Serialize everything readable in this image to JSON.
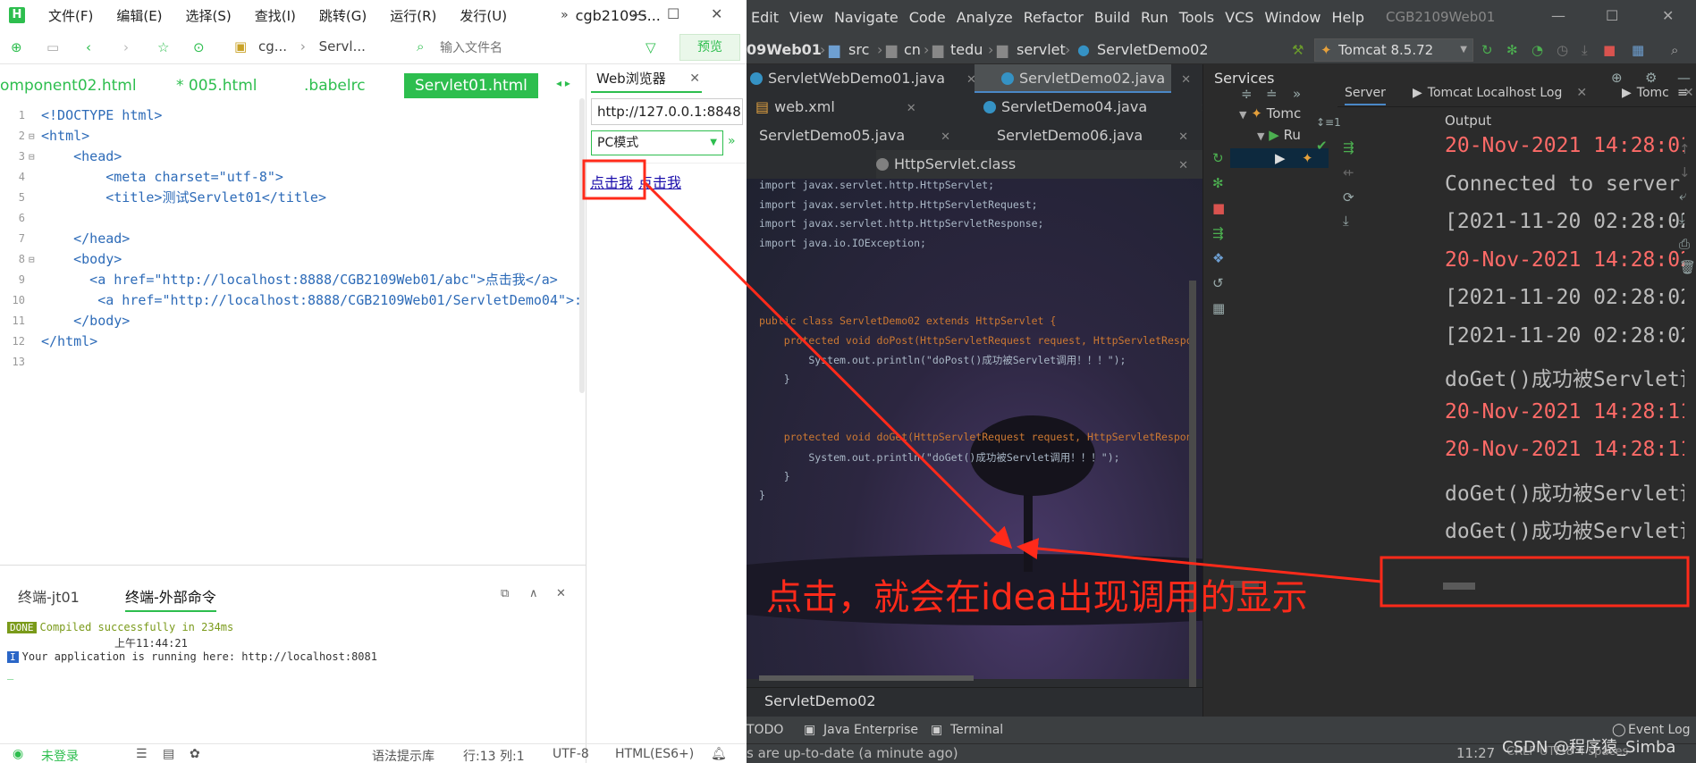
{
  "hbuilderx": {
    "menu": [
      "文件(F)",
      "编辑(E)",
      "选择(S)",
      "查找(I)",
      "跳转(G)",
      "运行(R)",
      "发行(U)"
    ],
    "title": "cgb2109S...",
    "toolbar": {
      "path": [
        "cg...",
        "Servl..."
      ],
      "file_input_placeholder": "输入文件名",
      "preview_label": "预览"
    },
    "tabs": [
      {
        "label": "omponent02.html"
      },
      {
        "label": "* 005.html"
      },
      {
        "label": ".babelrc"
      },
      {
        "label": "Servlet01.html",
        "active": true
      }
    ],
    "code_lines": [
      {
        "n": "1",
        "fold": "",
        "text": "<!DOCTYPE html>"
      },
      {
        "n": "2",
        "fold": "⊟",
        "text": "<html>"
      },
      {
        "n": "3",
        "fold": "⊟",
        "text": "    <head>"
      },
      {
        "n": "4",
        "fold": "",
        "text": "        <meta charset=\"utf-8\">"
      },
      {
        "n": "5",
        "fold": "",
        "text": "        <title>测试Servlet01</title>"
      },
      {
        "n": "6",
        "fold": "",
        "text": ""
      },
      {
        "n": "7",
        "fold": "",
        "text": "    </head>"
      },
      {
        "n": "8",
        "fold": "⊟",
        "text": "    <body>"
      },
      {
        "n": "9",
        "fold": "",
        "text": "      <a href=\"http://localhost:8888/CGB2109Web01/abc\">点击我</a>"
      },
      {
        "n": "10",
        "fold": "",
        "text": "       <a href=\"http://localhost:8888/CGB2109Web01/ServletDemo04\">:"
      },
      {
        "n": "11",
        "fold": "",
        "text": "    </body>"
      },
      {
        "n": "12",
        "fold": "",
        "text": "</html>"
      },
      {
        "n": "13",
        "fold": "",
        "text": ""
      }
    ],
    "browser": {
      "tab_label": "Web浏览器",
      "url": "http://127.0.0.1:8848",
      "mode": "PC模式",
      "links": [
        "点击我",
        "点击我"
      ]
    },
    "terminal": {
      "tabs": [
        "终端-jt01",
        "终端-外部命令"
      ],
      "lines": [
        {
          "badge": "DONE",
          "text": "Compiled successfully in 234ms"
        },
        {
          "badge": "",
          "text": "上午11:44:21"
        },
        {
          "badge": "I",
          "text": "Your application is running here: http://localhost:8081"
        },
        {
          "badge": "",
          "text": "_"
        }
      ]
    },
    "status": {
      "login": "未登录",
      "hint": "语法提示库",
      "position": "行:13  列:1",
      "encoding": "UTF-8",
      "language": "HTML(ES6+)"
    }
  },
  "idea": {
    "menu": [
      "Edit",
      "View",
      "Navigate",
      "Code",
      "Analyze",
      "Refactor",
      "Build",
      "Run",
      "Tools",
      "VCS",
      "Window",
      "Help"
    ],
    "project_title": "CGB2109Web01",
    "breadcrumb": [
      "09Web01",
      "src",
      "cn",
      "tedu",
      "servlet",
      "ServletDemo02"
    ],
    "run_config": "Tomcat 8.5.72",
    "editor_tabs": [
      [
        "ServletWebDemo01.java",
        "ServletDemo02.java"
      ],
      [
        "web.xml",
        "ServletDemo04.java"
      ],
      [
        "ServletDemo05.java",
        "ServletDemo06.java"
      ],
      [
        "HttpServlet.class"
      ]
    ],
    "editor_code": [
      "import javax.servlet.http.HttpServlet;",
      "import javax.servlet.http.HttpServletRequest;",
      "import javax.servlet.http.HttpServletResponse;",
      "import java.io.IOException;",
      "",
      "",
      "",
      "public class ServletDemo02 extends HttpServlet {",
      "    protected void doPost(HttpServletRequest request, HttpServletRespo",
      "        System.out.println(\"doPost()成功被Servlet调用！！！\");",
      "    }",
      "",
      "",
      "    protected void doGet(HttpServletRequest request, HttpServletRespon",
      "        System.out.println(\"doGet()成功被Servlet调用！！！\");",
      "    }",
      "}"
    ],
    "editor_footer": "ServletDemo02",
    "services": {
      "title": "Services",
      "tabs": [
        "Server",
        "Tomcat Localhost Log",
        "Tomc"
      ],
      "tree": [
        "Tomc",
        "Ru"
      ],
      "output_label": "Output",
      "console_lines": [
        {
          "text": "20-Nov-2021 14:28:01.",
          "color": "red"
        },
        {
          "text": "Connected to server",
          "color": "white"
        },
        {
          "text": "[2021-11-20 02:28:02,",
          "color": "white"
        },
        {
          "text": "20-Nov-2021 14:28:02.",
          "color": "red"
        },
        {
          "text": "[2021-11-20 02:28:02,",
          "color": "white"
        },
        {
          "text": "[2021-11-20 02:28:02,",
          "color": "white"
        },
        {
          "text": "doGet()成功被Servlet调",
          "color": "white"
        },
        {
          "text": "20-Nov-2021 14:28:11.",
          "color": "red"
        },
        {
          "text": "20-Nov-2021 14:28:11.",
          "color": "red"
        },
        {
          "text": "doGet()成功被Servlet调",
          "color": "white"
        },
        {
          "text": "doGet()成功被Servlet调",
          "color": "white"
        }
      ]
    },
    "bottom_tabs": [
      "TODO",
      "Java Enterprise",
      "Terminal"
    ],
    "event_log": "Event Log",
    "status_text": "s are up-to-date (a minute ago)",
    "status_time": "11:27",
    "status_misc": "CRLF  UTF-8  4 spaces"
  },
  "annotation": {
    "caption": "点击，就会在idea出现调用的显示",
    "color": "#ff2a1a"
  },
  "watermark": "CSDN @程序猿_Simba"
}
